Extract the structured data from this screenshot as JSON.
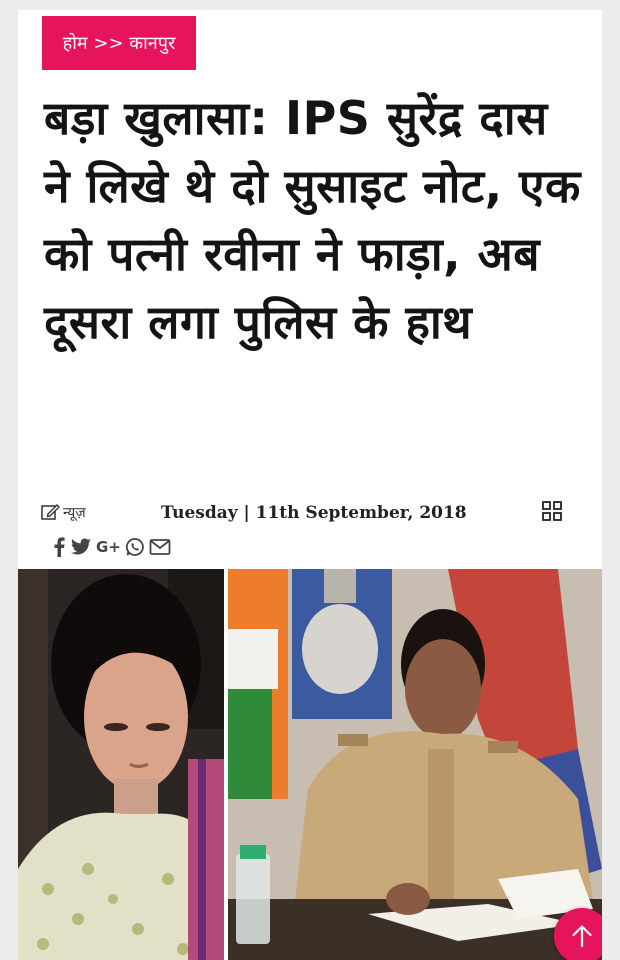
{
  "breadcrumb": {
    "home": "होम",
    "separator": ">>",
    "section": "कानपुर"
  },
  "article": {
    "headline": "बड़ा खुलासा: IPS सुरेंद्र दास ने लिखे थे दो सुसाइट नोट, एक को पत्नी रवीना ने फाड़ा, अब दूसरा लगा पुलिस के हाथ",
    "category": "न्यूज़",
    "date": "Tuesday | 11th September, 2018"
  },
  "share": {
    "icons": [
      "facebook-icon",
      "twitter-icon",
      "google-plus-icon",
      "whatsapp-icon",
      "email-icon"
    ],
    "gplus_label": "G+"
  },
  "colors": {
    "accent": "#e6145c",
    "headline": "#141414",
    "background": "#ececec"
  }
}
